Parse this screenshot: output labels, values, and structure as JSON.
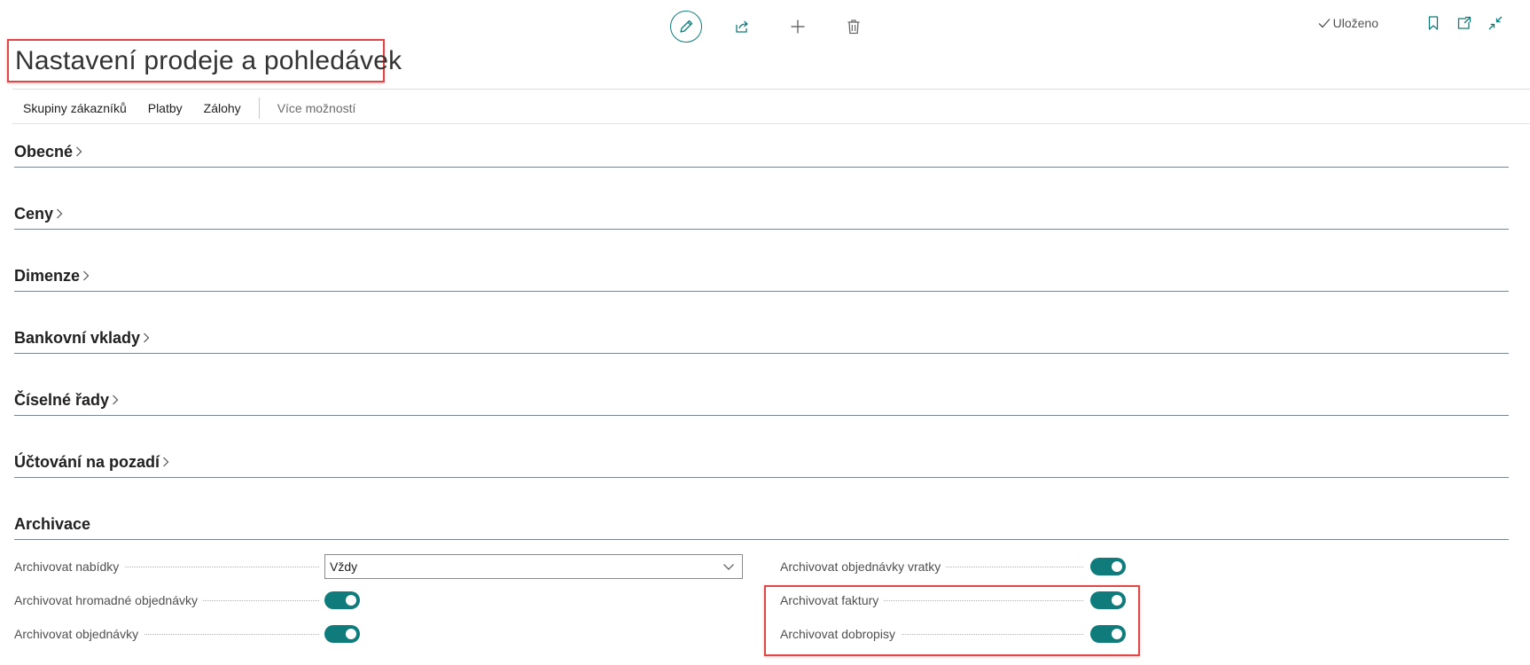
{
  "toolbar": {
    "icons": [
      "edit-icon",
      "share-icon",
      "add-icon",
      "delete-icon"
    ],
    "saved_label": "Uloženo",
    "right_icons": [
      "bookmark-icon",
      "open-new-window-icon",
      "collapse-icon"
    ]
  },
  "page": {
    "title": "Nastavení prodeje a pohledávek"
  },
  "actions": {
    "items": [
      "Skupiny zákazníků",
      "Platby",
      "Zálohy"
    ],
    "more": "Více možností"
  },
  "sections": [
    {
      "title": "Obecné",
      "collapsed": true
    },
    {
      "title": "Ceny",
      "collapsed": true
    },
    {
      "title": "Dimenze",
      "collapsed": true
    },
    {
      "title": "Bankovní vklady",
      "collapsed": true
    },
    {
      "title": "Číselné řady",
      "collapsed": true
    },
    {
      "title": "Účtování na pozadí",
      "collapsed": true
    },
    {
      "title": "Archivace",
      "collapsed": false
    }
  ],
  "archivace": {
    "left": [
      {
        "label": "Archivovat nabídky",
        "type": "select",
        "value": "Vždy"
      },
      {
        "label": "Archivovat hromadné objednávky",
        "type": "toggle",
        "value": true
      },
      {
        "label": "Archivovat objednávky",
        "type": "toggle",
        "value": true
      }
    ],
    "right": [
      {
        "label": "Archivovat objednávky vratky",
        "type": "toggle",
        "value": true
      },
      {
        "label": "Archivovat faktury",
        "type": "toggle",
        "value": true
      },
      {
        "label": "Archivovat dobropisy",
        "type": "toggle",
        "value": true
      }
    ]
  },
  "colors": {
    "accent": "#0f7b7b",
    "highlight": "#e04848"
  }
}
